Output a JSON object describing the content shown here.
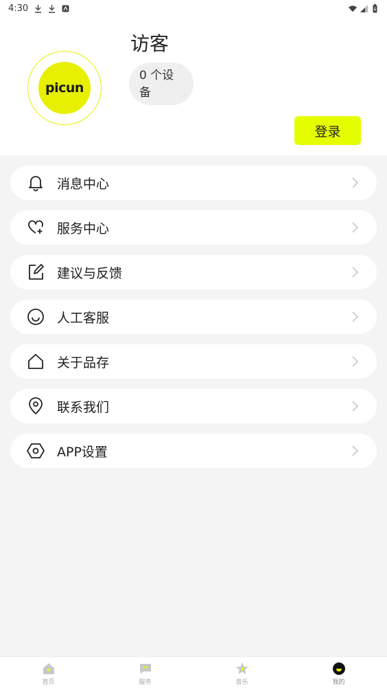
{
  "status_bar": {
    "time": "4:30"
  },
  "profile": {
    "avatar_text": "picun",
    "username": "访客",
    "device_count_line1": "0 个设",
    "device_count_line2": "备",
    "login_label": "登录"
  },
  "menu": {
    "items": [
      {
        "label": "消息中心",
        "icon": "bell-icon"
      },
      {
        "label": "服务中心",
        "icon": "heart-plus-icon"
      },
      {
        "label": "建议与反馈",
        "icon": "edit-icon"
      },
      {
        "label": "人工客服",
        "icon": "smile-icon"
      },
      {
        "label": "关于品存",
        "icon": "home-icon"
      },
      {
        "label": "联系我们",
        "icon": "location-icon"
      },
      {
        "label": "APP设置",
        "icon": "hexagon-settings-icon"
      }
    ]
  },
  "bottom_nav": {
    "items": [
      {
        "label": "首页",
        "icon": "home-icon"
      },
      {
        "label": "服务",
        "icon": "chat-icon"
      },
      {
        "label": "音乐",
        "icon": "star-icon"
      },
      {
        "label": "我的",
        "icon": "profile-icon"
      }
    ],
    "active_index": 3
  },
  "colors": {
    "accent": "#e6ff00",
    "background": "#f4f4f4",
    "card": "#ffffff"
  }
}
